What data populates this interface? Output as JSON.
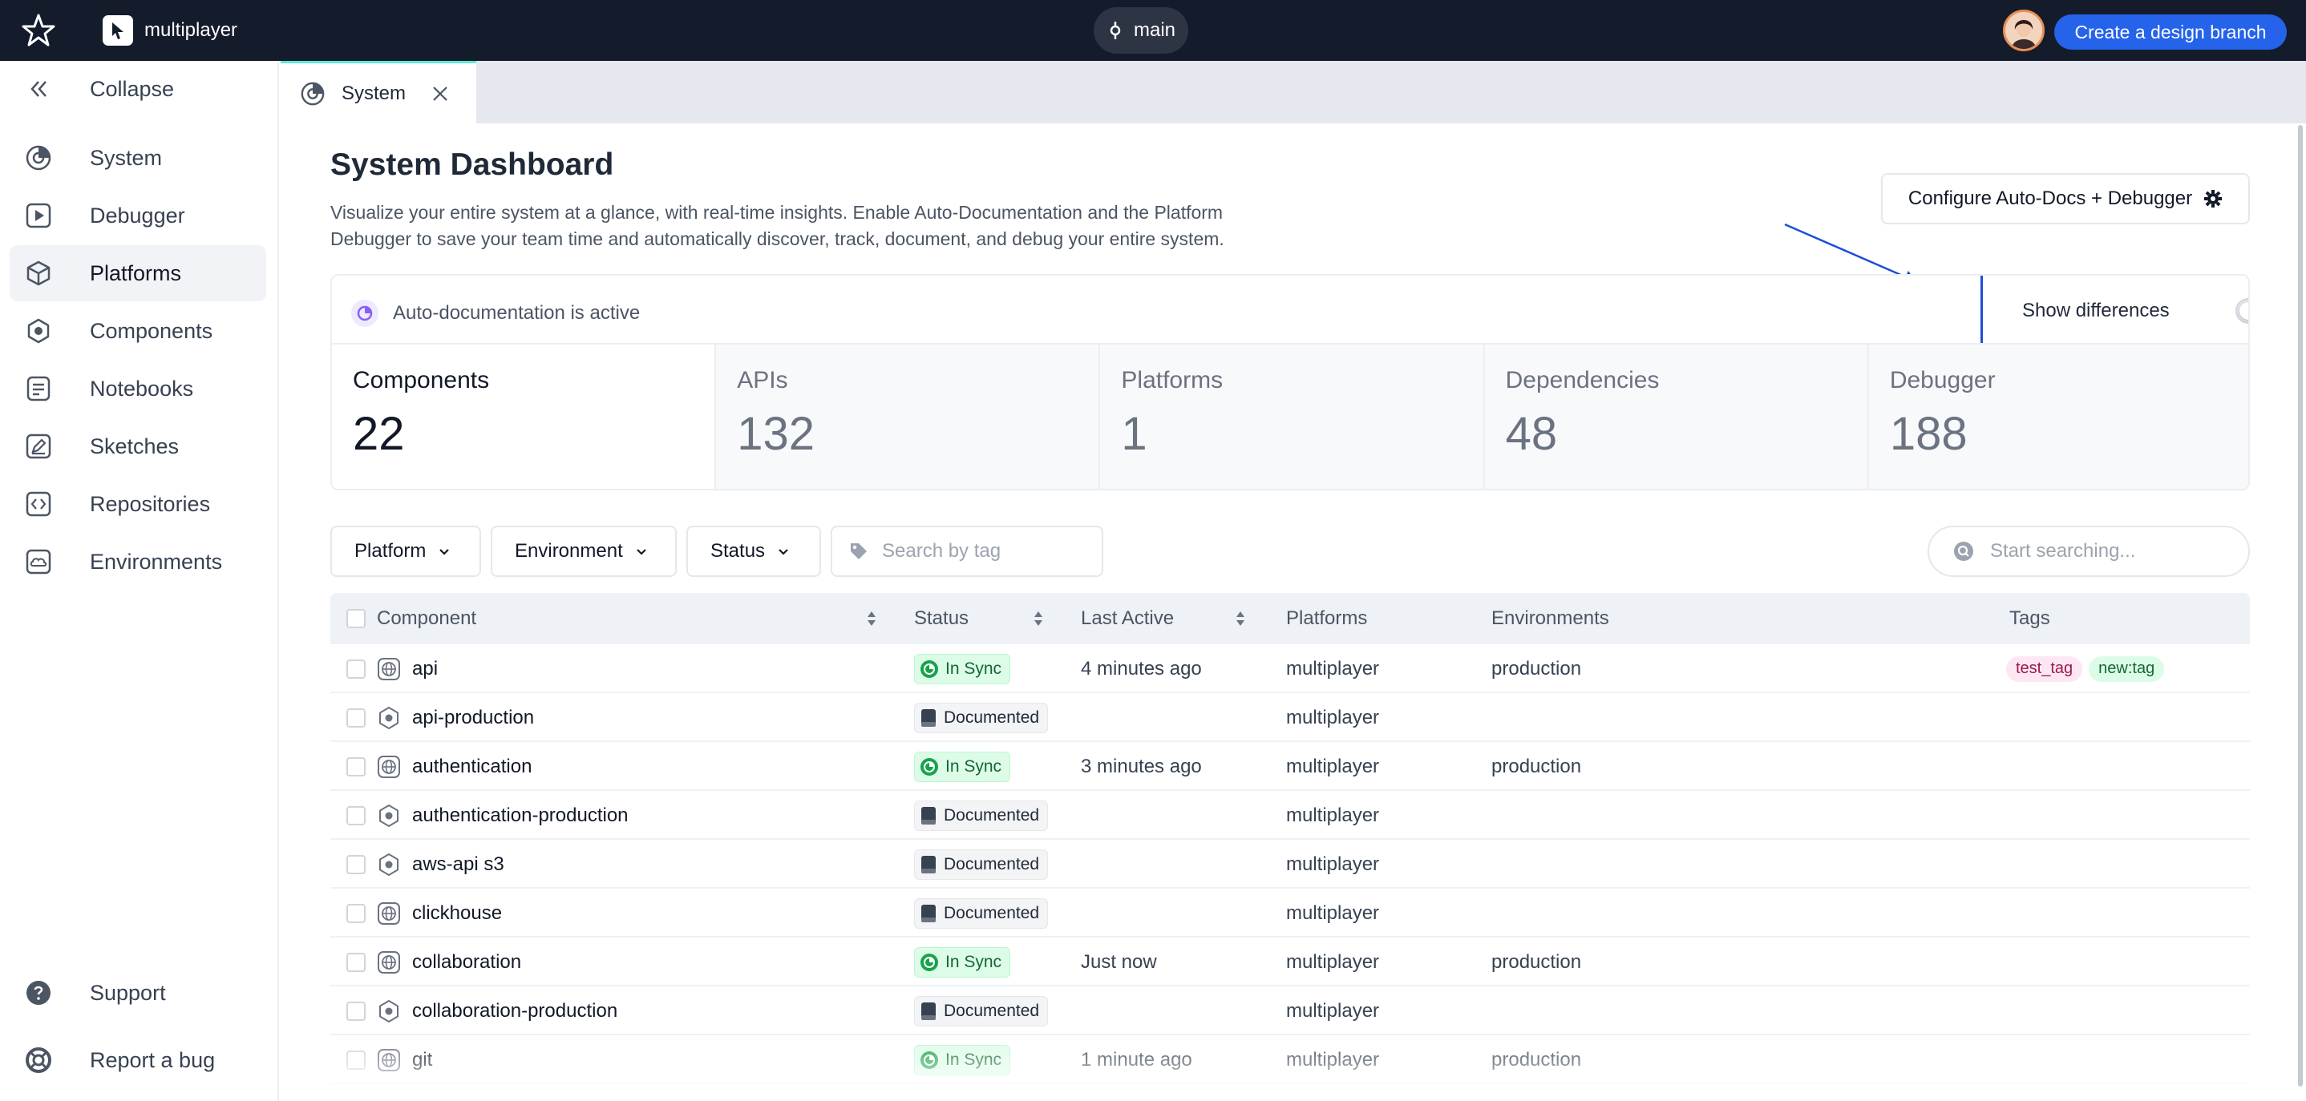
{
  "topbar": {
    "project_name": "multiplayer",
    "branch": "main",
    "create_branch_label": "Create a design branch"
  },
  "sidebar": {
    "collapse_label": "Collapse",
    "items": [
      {
        "label": "System",
        "icon": "system-icon"
      },
      {
        "label": "Debugger",
        "icon": "play-icon"
      },
      {
        "label": "Platforms",
        "icon": "cube-icon",
        "active": true
      },
      {
        "label": "Components",
        "icon": "hexagon-icon"
      },
      {
        "label": "Notebooks",
        "icon": "notebook-icon"
      },
      {
        "label": "Sketches",
        "icon": "pen-icon"
      },
      {
        "label": "Repositories",
        "icon": "code-icon"
      },
      {
        "label": "Environments",
        "icon": "cloud-icon"
      }
    ],
    "support_label": "Support",
    "report_label": "Report a bug"
  },
  "tab": {
    "label": "System"
  },
  "dashboard": {
    "title": "System Dashboard",
    "description": "Visualize your entire system at a glance, with real-time insights. Enable Auto-Documentation and the Platform Debugger to save your team time and automatically discover, track, document, and debug your entire system.",
    "configure_label": "Configure Auto-Docs + Debugger",
    "autodoc_status": "Auto-documentation is active",
    "show_differences_label": "Show differences",
    "stats": [
      {
        "label": "Components",
        "value": "22"
      },
      {
        "label": "APIs",
        "value": "132"
      },
      {
        "label": "Platforms",
        "value": "1"
      },
      {
        "label": "Dependencies",
        "value": "48"
      },
      {
        "label": "Debugger",
        "value": "188"
      }
    ]
  },
  "filters": {
    "platform": "Platform",
    "environment": "Environment",
    "status": "Status",
    "tag_search_placeholder": "Search by tag",
    "global_search_placeholder": "Start searching..."
  },
  "table": {
    "headers": {
      "component": "Component",
      "status": "Status",
      "last_active": "Last Active",
      "platforms": "Platforms",
      "environments": "Environments",
      "tags": "Tags"
    },
    "rows": [
      {
        "name": "api",
        "type": "globe",
        "status": "In Sync",
        "last_active": "4 minutes ago",
        "platform": "multiplayer",
        "environment": "production",
        "tags": [
          "test_tag",
          "new:tag"
        ]
      },
      {
        "name": "api-production",
        "type": "hex",
        "status": "Documented",
        "last_active": "",
        "platform": "multiplayer",
        "environment": "",
        "tags": []
      },
      {
        "name": "authentication",
        "type": "globe",
        "status": "In Sync",
        "last_active": "3 minutes ago",
        "platform": "multiplayer",
        "environment": "production",
        "tags": []
      },
      {
        "name": "authentication-production",
        "type": "hex",
        "status": "Documented",
        "last_active": "",
        "platform": "multiplayer",
        "environment": "",
        "tags": []
      },
      {
        "name": "aws-api s3",
        "type": "hex",
        "status": "Documented",
        "last_active": "",
        "platform": "multiplayer",
        "environment": "",
        "tags": []
      },
      {
        "name": "clickhouse",
        "type": "globe",
        "status": "Documented",
        "last_active": "",
        "platform": "multiplayer",
        "environment": "",
        "tags": []
      },
      {
        "name": "collaboration",
        "type": "globe",
        "status": "In Sync",
        "last_active": "Just now",
        "platform": "multiplayer",
        "environment": "production",
        "tags": []
      },
      {
        "name": "collaboration-production",
        "type": "hex",
        "status": "Documented",
        "last_active": "",
        "platform": "multiplayer",
        "environment": "",
        "tags": []
      },
      {
        "name": "git",
        "type": "globe",
        "status": "In Sync",
        "last_active": "1 minute ago",
        "platform": "multiplayer",
        "environment": "production",
        "tags": []
      }
    ]
  },
  "colors": {
    "topbar_bg": "#141b2b",
    "accent_blue": "#2563eb",
    "active_tab_underline": "#4f46e5",
    "sync_badge_bg": "#dcfce7",
    "annotation_blue": "#1d4ed8"
  }
}
